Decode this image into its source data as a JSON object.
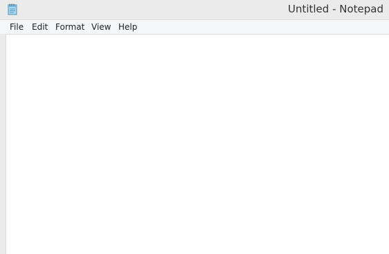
{
  "window": {
    "title": "Untitled - Notepad",
    "icon": "notepad-icon"
  },
  "menu": {
    "items": [
      {
        "label": "File"
      },
      {
        "label": "Edit"
      },
      {
        "label": "Format"
      },
      {
        "label": "View"
      },
      {
        "label": "Help"
      }
    ]
  },
  "editor": {
    "content": ""
  },
  "colors": {
    "titlebar": "#ebebeb",
    "menubar": "#f5f6f7",
    "editor_background": "#ffffff",
    "text": "#333333"
  }
}
